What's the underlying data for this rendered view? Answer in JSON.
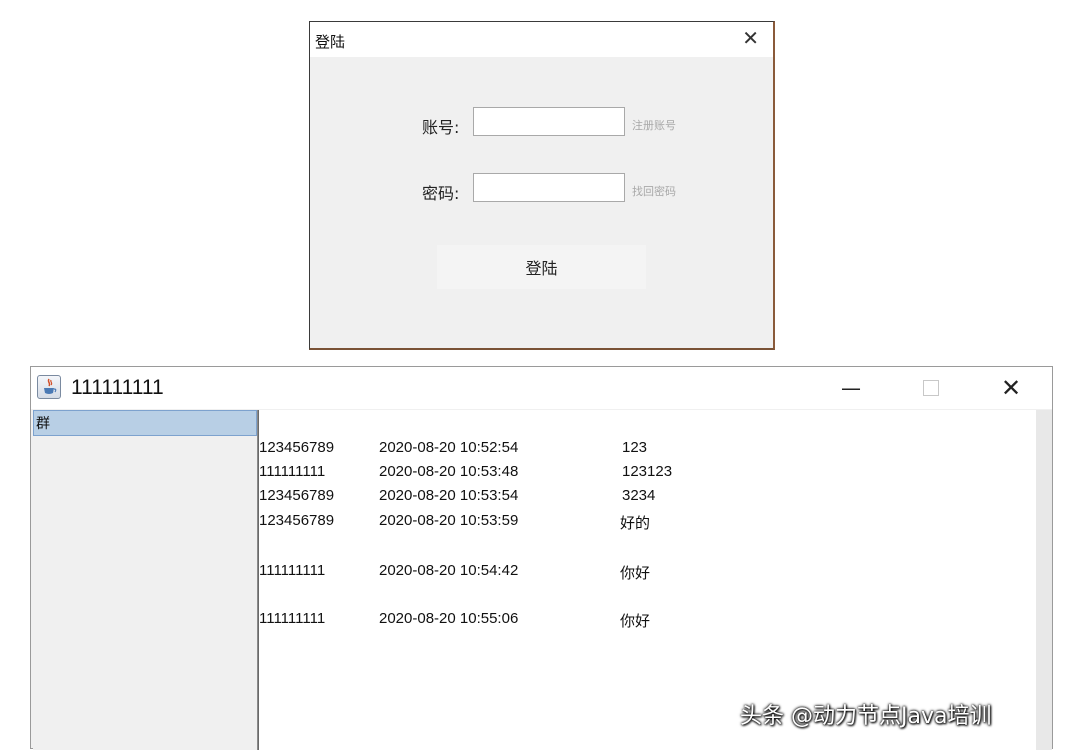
{
  "login": {
    "title": "登陆",
    "close_icon": "close-icon",
    "account_label": "账号:",
    "account_value": "",
    "register_link": "注册账号",
    "password_label": "密码:",
    "password_value": "",
    "recover_link": "找回密码",
    "login_button": "登陆"
  },
  "chat": {
    "title": "111111111",
    "app_icon": "java-icon",
    "group_list": [
      {
        "label": "群",
        "selected": true
      }
    ],
    "messages": [
      {
        "user": "123456789",
        "time": "2020-08-20 10:52:54",
        "text": "123"
      },
      {
        "user": "111111111",
        "time": "2020-08-20 10:53:48",
        "text": "123123"
      },
      {
        "user": "123456789",
        "time": "2020-08-20 10:53:54",
        "text": "3234"
      },
      {
        "user": "123456789",
        "time": "2020-08-20 10:53:59",
        "text": "好的"
      },
      {
        "user": "111111111",
        "time": "2020-08-20 10:54:42",
        "text": "你好"
      },
      {
        "user": "111111111",
        "time": "2020-08-20 10:55:06",
        "text": "你好"
      }
    ]
  },
  "watermark": "头条 @动力节点Java培训",
  "colors": {
    "selected_item_bg": "#b8cfe5",
    "window_bg": "#f0f0f0",
    "link_text": "#a8a8a8"
  }
}
